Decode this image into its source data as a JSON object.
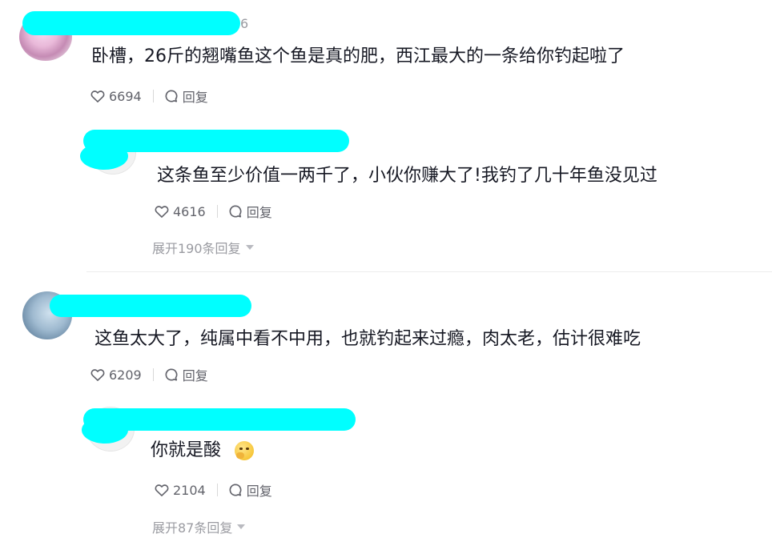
{
  "comments": [
    {
      "name_fragment": "6",
      "text": "卧槽，26斤的翘嘴鱼这个鱼是真的肥，西江最大的一条给你钓起啦了",
      "likes": "6694",
      "reply_label": "回复",
      "replies": [
        {
          "text": "这条鱼至少价值一两千了，小伙你赚大了!我钓了几十年鱼没见过",
          "likes": "4616",
          "reply_label": "回复"
        }
      ],
      "expand_label": "展开190条回复"
    },
    {
      "text": "这鱼太大了，纯属中看不中用，也就钓起来过瘾，肉太老，估计很难吃",
      "likes": "6209",
      "reply_label": "回复",
      "replies": [
        {
          "text": "你就是酸",
          "emoji": "thinking-face-icon",
          "likes": "2104",
          "reply_label": "回复"
        }
      ],
      "expand_label": "展开87条回复"
    }
  ],
  "colors": {
    "redaction": "#00ffff",
    "text": "#161823",
    "meta": "#62636b",
    "muted": "#9a9ba1"
  }
}
